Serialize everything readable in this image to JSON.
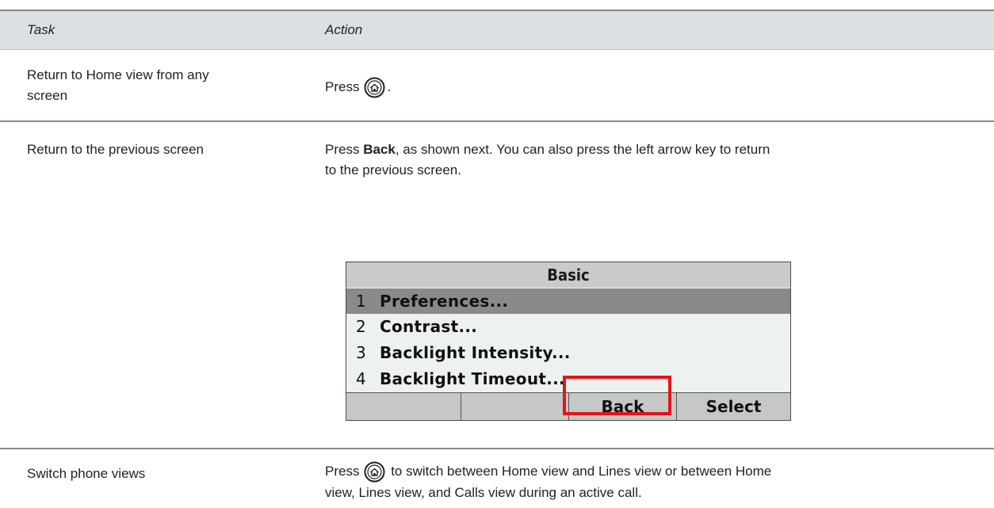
{
  "table": {
    "headers": {
      "task": "Task",
      "action": "Action"
    },
    "rows": [
      {
        "task_line1": "Return to Home view from any",
        "task_line2": "screen",
        "action_before": "Press",
        "action_after": "."
      },
      {
        "task": "Return to the previous screen",
        "action_press": "Press",
        "action_bold": "Back",
        "action_rest": ", as shown next. You can also press the left arrow key to return",
        "action_line2": "to the previous screen."
      },
      {
        "task": "Switch phone views",
        "action_before": "Press",
        "action_after": "to switch between Home view and Lines view or between Home",
        "action_line2": "view, Lines view, and Calls view during an active call."
      }
    ]
  },
  "phone_screen": {
    "title": "Basic",
    "items": [
      {
        "num": "1",
        "label": "Preferences...",
        "selected": true
      },
      {
        "num": "2",
        "label": "Contrast..."
      },
      {
        "num": "3",
        "label": "Backlight Intensity..."
      },
      {
        "num": "4",
        "label": "Backlight Timeout..."
      }
    ],
    "softkeys": [
      "",
      "",
      "Back",
      "Select"
    ]
  },
  "colors": {
    "highlight": "#e3141b",
    "header_bg": "#dde0e3",
    "rule": "#7f8a93"
  },
  "icons": {
    "home": "home-key-icon"
  }
}
